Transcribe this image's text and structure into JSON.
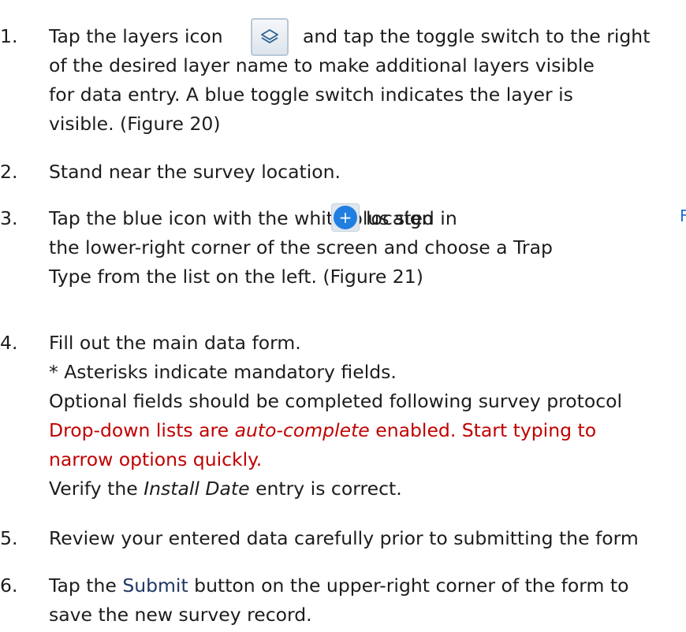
{
  "steps": [
    {
      "number": "1.",
      "lines": {
        "l1a": "Tap the layers icon",
        "l1b": "and tap the toggle switch to the right",
        "l2": "of the desired layer name to make additional layers visible",
        "l3": "for data entry. A blue toggle switch indicates the layer is",
        "l4": "visible. (Figure 20)"
      },
      "icon": "layers-icon"
    },
    {
      "number": "2.",
      "lines": {
        "l1": "Stand near the survey location."
      }
    },
    {
      "number": "3.",
      "lines": {
        "l1a": "Tap the blue icon with the white plus sign",
        "l1b": "located in",
        "l2": "the lower-right corner of the screen and choose a Trap",
        "l3": "Type from the list on the left. (Figure 21)"
      },
      "icon": "plus-icon",
      "icon_glyph": "+"
    },
    {
      "number": "4.",
      "lines": {
        "l1": "Fill out the main data form.",
        "l2": "* Asterisks indicate mandatory fields.",
        "l3": "Optional fields should be completed following survey protocol",
        "l4a": "Drop-down lists are",
        "l4em": "auto-complete",
        "l4b": "enabled.  Start typing to",
        "l5": "narrow options quickly.",
        "l6a": "Verify the",
        "l6em": "Install Date",
        "l6b": "entry is correct."
      }
    },
    {
      "number": "5.",
      "lines": {
        "l1": "Review your entered data carefully prior to submitting the form"
      }
    },
    {
      "number": "6.",
      "lines": {
        "l1a": "Tap the",
        "l1b": "Submit",
        "l1c": "button on the upper-right corner of the form to",
        "l2": "save the new survey record."
      }
    }
  ],
  "side_fragment": "F",
  "colors": {
    "text": "#1c1c1c",
    "emphasis_red": "#c00000",
    "submit_word": "#1f3864",
    "plus_blue": "#1f7ee0"
  }
}
